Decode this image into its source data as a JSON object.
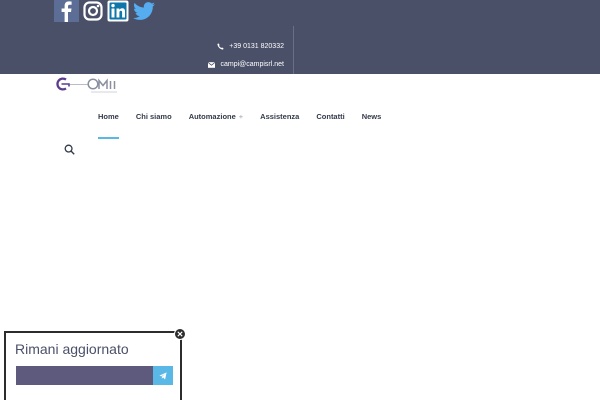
{
  "header": {
    "social": [
      {
        "icon": "facebook-icon",
        "color": "#3b5998"
      },
      {
        "icon": "instagram-icon",
        "color": "#ffffff"
      },
      {
        "icon": "linkedin-icon",
        "color": "#0e76a8"
      },
      {
        "icon": "twitter-icon",
        "color": "#55acee"
      }
    ],
    "phone": "+39 0131 820332",
    "email": "campi@campisrl.net"
  },
  "logo": {
    "primary": "#5e3b8f",
    "secondary": "#8a8fa0"
  },
  "nav": {
    "items": [
      {
        "label": "Home",
        "active": true
      },
      {
        "label": "Chi siamo"
      },
      {
        "label": "Automazione",
        "submenu": "+"
      },
      {
        "label": "Assistenza"
      },
      {
        "label": "Contatti"
      },
      {
        "label": "News"
      }
    ],
    "accent": "#5ab8e6"
  },
  "popup": {
    "title": "Rimani aggiornato",
    "field_color": "#5e5a7e",
    "button_color": "#5ab8e6"
  }
}
